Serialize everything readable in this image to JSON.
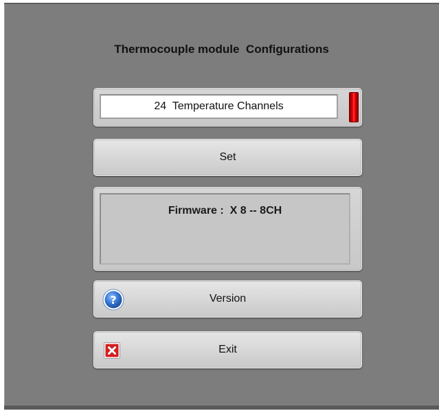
{
  "window": {
    "title": "Thermocouple module  Configurations"
  },
  "channels": {
    "value": "24  Temperature Channels",
    "indicator_color": "#e40000"
  },
  "buttons": {
    "set_label": "Set",
    "version_label": "Version",
    "exit_label": "Exit"
  },
  "firmware": {
    "text": "Firmware :  X 8 -- 8CH"
  },
  "icons": {
    "version": "help-question-icon",
    "exit": "close-x-icon"
  },
  "colors": {
    "background": "#7d7d7d",
    "button_face": "#d9d9d9",
    "indicator": "#e40000",
    "help_icon": "#2f6fc4",
    "exit_icon": "#d32020"
  }
}
